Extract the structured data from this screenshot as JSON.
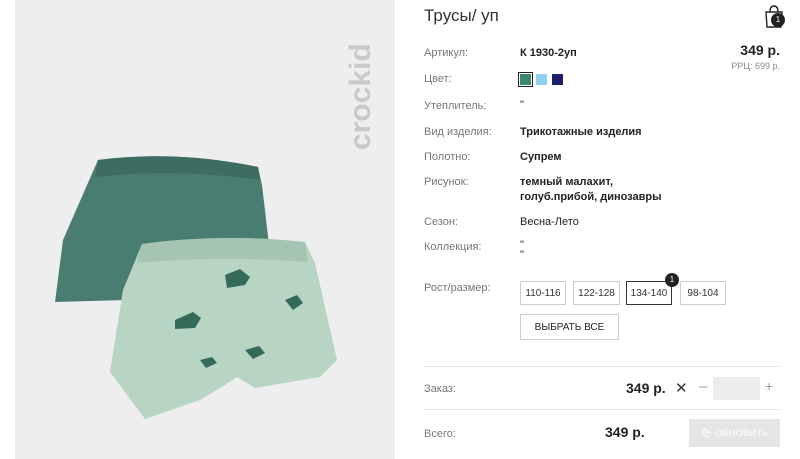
{
  "product": {
    "title": "Трусы/ уп",
    "brand": "crockid",
    "price": "349 р.",
    "rrp": "РРЦ: 699 р."
  },
  "cart": {
    "badge": "1",
    "icon": "shopping-bag-icon"
  },
  "specs": {
    "article_label": "Артикул:",
    "article_value": "К 1930-2уп",
    "color_label": "Цвет:",
    "insulation_label": "Утеплитель:",
    "insulation_value": "\"",
    "type_label": "Вид изделия:",
    "type_value": "Трикотажные изделия",
    "fabric_label": "Полотно:",
    "fabric_value": "Супрем",
    "pattern_label": "Рисунок:",
    "pattern_line1": "темный малахит,",
    "pattern_line2": "голуб.прибой, динозавры",
    "season_label": "Сезон:",
    "season_value": "Весна-Лето",
    "collection_label": "Коллекция:",
    "collection_line1": "\"",
    "collection_line2": "\""
  },
  "colors": [
    "#3d8a6a",
    "#8fd0ef",
    "#1d1f6e"
  ],
  "sizes": {
    "label": "Рост/размер:",
    "options": [
      "110-116",
      "122-128",
      "134-140",
      "98-104"
    ],
    "selected": "134-140",
    "selected_badge": "1",
    "select_all": "ВЫБРАТЬ ВСЕ"
  },
  "order": {
    "label": "Заказ:",
    "price": "349 р.",
    "quantity": ""
  },
  "total": {
    "label": "Всего:",
    "value": "349 р.",
    "update_button": "ОБНОВИТЬ"
  }
}
